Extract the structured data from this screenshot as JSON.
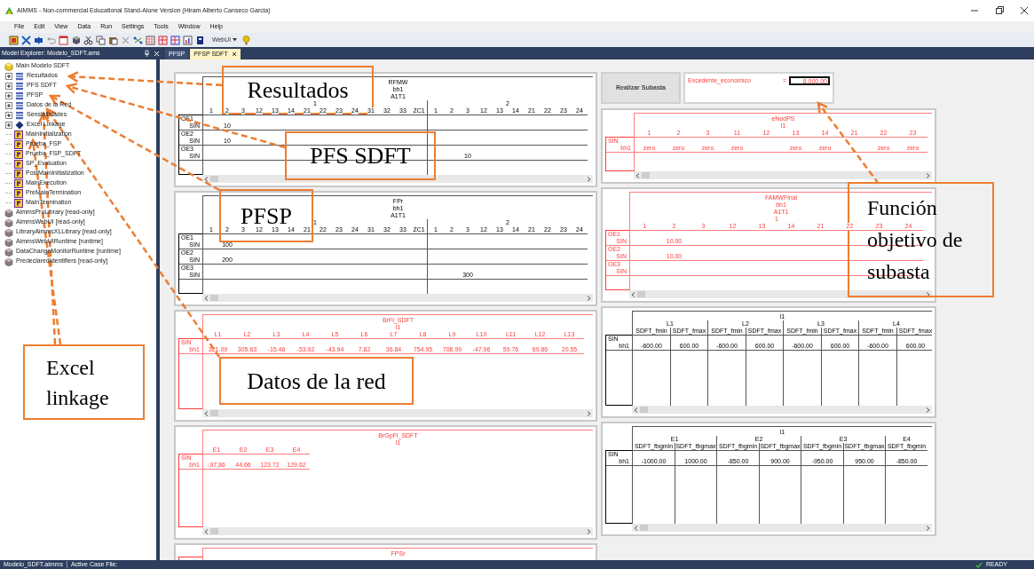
{
  "window": {
    "title": "AIMMS - Non-commercial Educational Stand-Alone Version (Hiram Alberto Canseco Garcia)"
  },
  "menu": [
    "File",
    "Edit",
    "View",
    "Data",
    "Run",
    "Settings",
    "Tools",
    "Window",
    "Help"
  ],
  "toolbar": {
    "dropdown": "WebUI"
  },
  "explorer": {
    "title": "Model Explorer: Modelo_SDFT.ams",
    "tree": [
      {
        "label": "Main Modelo SDFT",
        "kind": "model",
        "children": [
          {
            "label": "Resultados",
            "kind": "section",
            "expanded": false
          },
          {
            "label": "PFS SDFT",
            "kind": "section",
            "expanded": false
          },
          {
            "label": "PFSP",
            "kind": "section",
            "expanded": false
          },
          {
            "label": "Datos de la Red",
            "kind": "section",
            "expanded": false
          },
          {
            "label": "Sensibilidades",
            "kind": "section",
            "expanded": false
          },
          {
            "label": "Excel Linkage",
            "kind": "library",
            "expanded": false
          },
          {
            "label": "MainInitialization",
            "kind": "procedure"
          },
          {
            "label": "Prueba_FSP",
            "kind": "procedure"
          },
          {
            "label": "Prueba_FSP_SDFT",
            "kind": "procedure"
          },
          {
            "label": "SP_Evaluation",
            "kind": "procedure"
          },
          {
            "label": "PostMainInitialization",
            "kind": "procedure"
          },
          {
            "label": "MainExecution",
            "kind": "procedure"
          },
          {
            "label": "PreMainTermination",
            "kind": "procedure"
          },
          {
            "label": "MainTermination",
            "kind": "procedure"
          }
        ]
      },
      {
        "label": "AimmsProLibrary [read-only]",
        "kind": "module"
      },
      {
        "label": "AimmsWebUI [read-only]",
        "kind": "module"
      },
      {
        "label": "LibraryAimmsXLLibrary [read-only]",
        "kind": "module"
      },
      {
        "label": "AimmsWebUIRuntime [runtime]",
        "kind": "module"
      },
      {
        "label": "DataChangeMonitorRuntime [runtime]",
        "kind": "module"
      },
      {
        "label": "PredeclaredIdentifiers [read-only]",
        "kind": "module"
      }
    ]
  },
  "tabs": [
    {
      "label": "PFSP",
      "selected": false,
      "closable": false
    },
    {
      "label": "PFSP SDFT",
      "selected": true,
      "closable": true
    }
  ],
  "page": {
    "button": "Realizar Subasta",
    "scalar": {
      "label": "Excedente_economico",
      "equals": "=",
      "value": "8,000.00"
    },
    "tables": [
      {
        "color": "#000000",
        "header": [
          "RFMW",
          "bh1",
          "A1T1"
        ],
        "groups": [
          {
            "label": "1",
            "columns": [
              "1",
              "2",
              "3",
              "12",
              "13",
              "14",
              "21",
              "22",
              "23",
              "24",
              "31",
              "32",
              "33",
              "ZC1"
            ]
          },
          {
            "label": "2",
            "columns": [
              "1",
              "2",
              "3",
              "12",
              "13",
              "14",
              "21",
              "22",
              "23",
              "24"
            ]
          }
        ],
        "rows": [
          {
            "group": "OE1",
            "label": "SIN",
            "cells": [
              null,
              "10",
              null,
              null,
              null,
              null,
              null,
              null,
              null,
              null,
              null,
              null,
              null,
              null,
              null,
              null,
              null,
              null,
              null,
              null,
              null,
              null,
              null,
              null
            ]
          },
          {
            "group": "OE2",
            "label": "SIN",
            "cells": [
              null,
              "10",
              null,
              null,
              null,
              null,
              null,
              null,
              null,
              null,
              null,
              null,
              null,
              null,
              null,
              null,
              null,
              null,
              null,
              null,
              null,
              null,
              null,
              null
            ]
          },
          {
            "group": "OE3",
            "label": "SIN",
            "cells": [
              null,
              null,
              null,
              null,
              null,
              null,
              null,
              null,
              null,
              null,
              null,
              null,
              null,
              null,
              null,
              null,
              "10",
              null,
              null,
              null,
              null,
              null,
              null,
              null
            ]
          }
        ]
      },
      {
        "color": "#ff3b3b",
        "header": [
          "eNodPS",
          "l1"
        ],
        "groups": [
          {
            "columns": [
              "1",
              "2",
              "3",
              "11",
              "12",
              "13",
              "14",
              "21",
              "22",
              "23"
            ]
          }
        ],
        "rows": [
          {
            "group": "SIN",
            "label": "bh1",
            "cells": [
              "zero",
              "zero",
              "zero",
              "zero",
              null,
              "zero",
              "zero",
              null,
              "zero",
              "zero"
            ]
          }
        ]
      },
      {
        "color": "#000000",
        "header": [
          "FPr",
          "bh1",
          "A1T1"
        ],
        "groups": [
          {
            "label": "1",
            "columns": [
              "1",
              "2",
              "3",
              "12",
              "13",
              "14",
              "21",
              "22",
              "23",
              "24",
              "31",
              "32",
              "33",
              "ZC1"
            ]
          },
          {
            "label": "2",
            "columns": [
              "1",
              "2",
              "3",
              "12",
              "13",
              "14",
              "21",
              "22",
              "23",
              "24"
            ]
          }
        ],
        "rows": [
          {
            "group": "OE1",
            "label": "SIN",
            "cells": [
              null,
              "100",
              null,
              null,
              null,
              null,
              null,
              null,
              null,
              null,
              null,
              null,
              null,
              null,
              null,
              null,
              null,
              null,
              null,
              null,
              null,
              null,
              null,
              null
            ]
          },
          {
            "group": "OE2",
            "label": "SIN",
            "cells": [
              null,
              "200",
              null,
              null,
              null,
              null,
              null,
              null,
              null,
              null,
              null,
              null,
              null,
              null,
              null,
              null,
              null,
              null,
              null,
              null,
              null,
              null,
              null,
              null
            ]
          },
          {
            "group": "OE3",
            "label": "SIN",
            "cells": [
              null,
              null,
              null,
              null,
              null,
              null,
              null,
              null,
              null,
              null,
              null,
              null,
              null,
              null,
              null,
              null,
              "300",
              null,
              null,
              null,
              null,
              null,
              null,
              null
            ]
          }
        ]
      },
      {
        "color": "#ff3b3b",
        "header": [
          "FAMWFinal",
          "bh1",
          "A1T1"
        ],
        "groups": [
          {
            "label": "1",
            "columns": [
              "1",
              "2",
              "3",
              "12",
              "13",
              "14",
              "21",
              "22",
              "23",
              "24"
            ]
          }
        ],
        "rows": [
          {
            "group": "OE1",
            "label": "SIN",
            "cells": [
              null,
              "10.00",
              null,
              null,
              null,
              null,
              null,
              null,
              null,
              null
            ]
          },
          {
            "group": "OE2",
            "label": "SIN",
            "cells": [
              null,
              "10.00",
              null,
              null,
              null,
              null,
              null,
              null,
              null,
              null
            ]
          },
          {
            "group": "OE3",
            "label": "SIN",
            "cells": [
              null,
              null,
              null,
              null,
              null,
              null,
              null,
              null,
              null,
              null
            ]
          }
        ]
      },
      {
        "color": "#ff3b3b",
        "header": [
          "BrFl_SDFT",
          "l1"
        ],
        "groups": [
          {
            "columns": [
              "L1",
              "L2",
              "L3",
              "L4",
              "L5",
              "L6",
              "L7",
              "L8",
              "L9",
              "L10",
              "L11",
              "L12",
              "L13"
            ]
          }
        ],
        "rows": [
          {
            "group": "SIN",
            "label": "bh1",
            "cells": [
              "321.09",
              "305.63",
              "-15.46",
              "-53.92",
              "-43.94",
              "7.82",
              "36.84",
              "754.95",
              "706.99",
              "-47.96",
              "59.76",
              "69.86",
              "20.55"
            ]
          }
        ]
      },
      {
        "color": "#000000",
        "header": [
          "l1"
        ],
        "groups": [
          {
            "label": "L1",
            "columns": [
              "SDFT_fmin",
              "SDFT_fmax"
            ]
          },
          {
            "label": "L2",
            "columns": [
              "SDFT_fmin",
              "SDFT_fmax"
            ]
          },
          {
            "label": "L3",
            "columns": [
              "SDFT_fmin",
              "SDFT_fmax"
            ]
          },
          {
            "label": "L4",
            "columns": [
              "SDFT_fmin",
              "SDFT_fmax"
            ]
          }
        ],
        "rows": [
          {
            "group": "SIN",
            "label": "bh1",
            "cells": [
              "-600.00",
              "600.00",
              "-600.00",
              "600.00",
              "-600.00",
              "600.00",
              "-600.00",
              "600.00"
            ]
          }
        ]
      },
      {
        "color": "#ff3b3b",
        "header": [
          "BrGpFl_SDFT",
          "l1"
        ],
        "groups": [
          {
            "columns": [
              "E1",
              "E2",
              "E3",
              "E4"
            ]
          }
        ],
        "rows": [
          {
            "group": "SIN",
            "label": "bh1",
            "cells": [
              "-97.86",
              "44.66",
              "123.72",
              "129.62"
            ]
          }
        ]
      },
      {
        "color": "#000000",
        "header": [
          "l1"
        ],
        "groups": [
          {
            "label": "E1",
            "columns": [
              "SDFT_fbgmin",
              "SDFT_fbgmax"
            ]
          },
          {
            "label": "E2",
            "columns": [
              "SDFT_fbgmin",
              "SDFT_fbgmax"
            ]
          },
          {
            "label": "E3",
            "columns": [
              "SDFT_fbgmin",
              "SDFT_fbgmax"
            ]
          },
          {
            "label": "E4",
            "columns": [
              "SDFT_fbgmin"
            ]
          }
        ],
        "rows": [
          {
            "group": "SIN",
            "label": "bh1",
            "cells": [
              "-1000.00",
              "1000.00",
              "-850.00",
              "900.00",
              "-950.00",
              "950.00",
              "-850.00"
            ]
          }
        ]
      },
      {
        "color": "#ff3b3b",
        "header": [
          "FPSr"
        ]
      }
    ]
  },
  "annotations": [
    {
      "text": "Resultados"
    },
    {
      "text": "PFS SDFT"
    },
    {
      "text": "PFSP"
    },
    {
      "text": "Función objetivo de subasta"
    },
    {
      "text": "Excel linkage"
    },
    {
      "text": "Datos de la red"
    }
  ],
  "status_bar": {
    "file": "Modelo_SDFT.aimms",
    "case": "Active Case File:",
    "state": "READY"
  }
}
